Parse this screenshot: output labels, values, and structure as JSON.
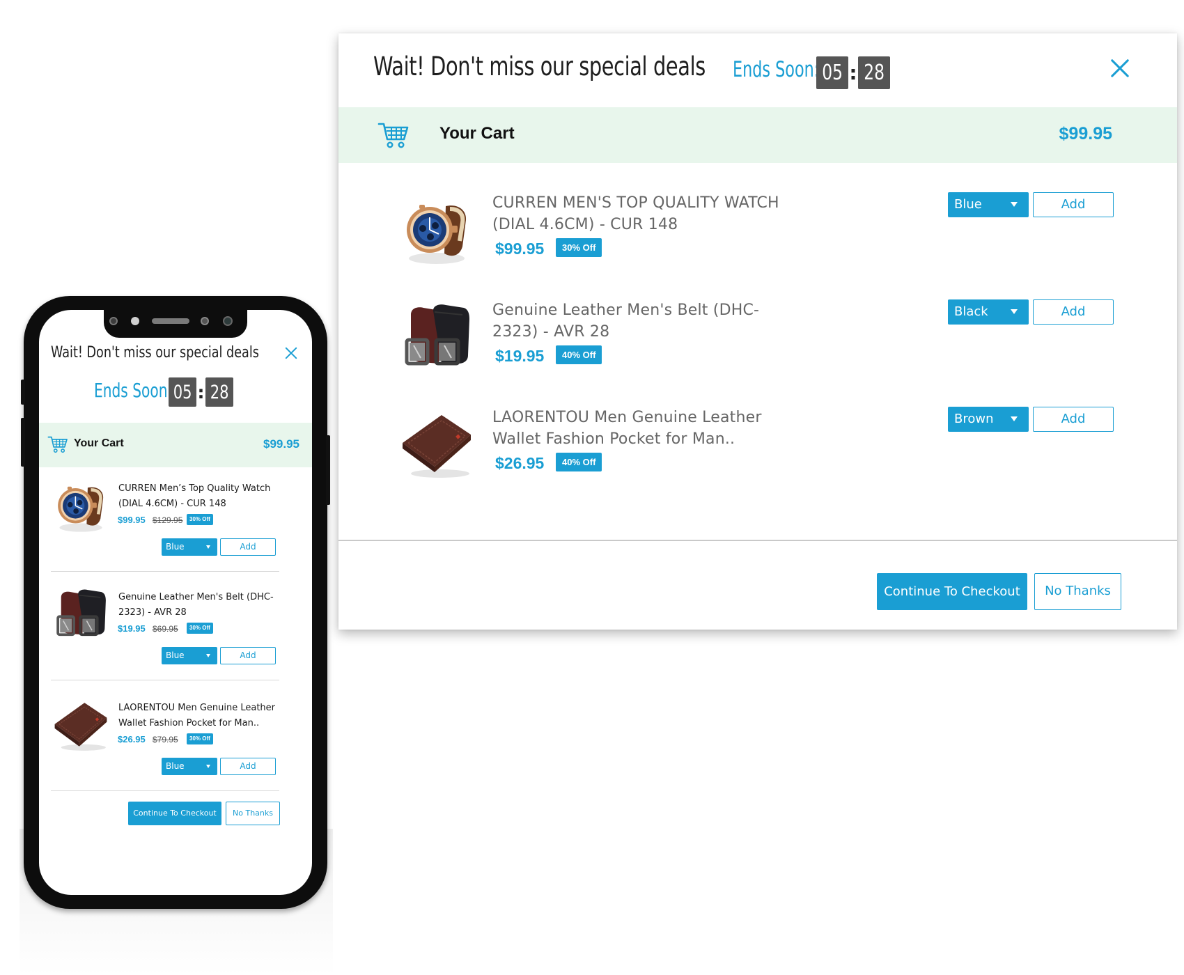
{
  "popup": {
    "title": "Wait! Don't miss our special deals",
    "ends_label": "Ends Soon:",
    "timer": {
      "minutes": "05",
      "colon": ":",
      "seconds": "28"
    },
    "cart": {
      "label": "Your Cart",
      "total": "$99.95",
      "icon": "shopping-cart-icon"
    },
    "close_icon": "close-icon",
    "accent_color": "#1a9ed3",
    "cart_bar_color": "#e8f6ec",
    "checkout_label": "Continue To Checkout",
    "no_thanks_label": "No Thanks",
    "add_label": "Add"
  },
  "desktop_items": [
    {
      "name": "CURREN MEN'S TOP QUALITY WATCH (DIAL 4.6CM) - CUR 148",
      "price": "$99.95",
      "discount": "30% Off",
      "option": "Blue",
      "image": "watch"
    },
    {
      "name": "Genuine Leather Men's Belt (DHC-2323) - AVR 28",
      "price": "$19.95",
      "discount": "40% Off",
      "option": "Black",
      "image": "belt"
    },
    {
      "name": "LAORENTOU Men Genuine Leather Wallet Fashion Pocket for Man..",
      "price": "$26.95",
      "discount": "40% Off",
      "option": "Brown",
      "image": "wallet"
    }
  ],
  "mobile_items": [
    {
      "name": "CURREN Men’s Top Quality Watch (DIAL 4.6CM) - CUR 148",
      "price": "$99.95",
      "old_price": "$129.95",
      "discount": "30% Off",
      "option": "Blue",
      "image": "watch"
    },
    {
      "name": "Genuine Leather Men's Belt (DHC-2323) - AVR 28",
      "price": "$19.95",
      "old_price": "$69.95",
      "discount": "30% Off",
      "option": "Blue",
      "image": "belt"
    },
    {
      "name": "LAORENTOU Men Genuine Leather Wallet Fashion Pocket for Man..",
      "price": "$26.95",
      "old_price": "$79.95",
      "discount": "30% Off",
      "option": "Blue",
      "image": "wallet"
    }
  ]
}
